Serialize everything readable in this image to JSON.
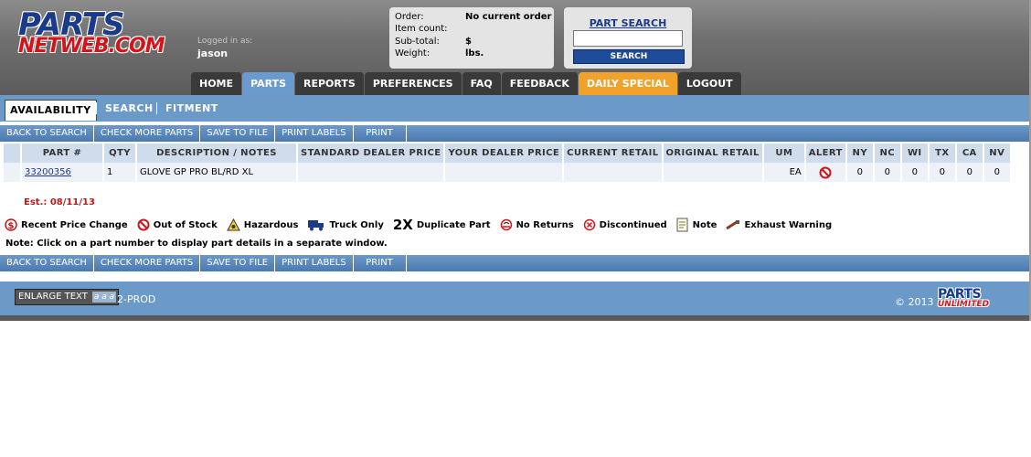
{
  "logo": {
    "line1": "PARTS",
    "line2": "NETWEB.COM"
  },
  "login": {
    "label": "Logged in as:",
    "user": "jason"
  },
  "order": {
    "rows": [
      {
        "label": "Order:",
        "value": "No current order"
      },
      {
        "label": "Item count:",
        "value": ""
      },
      {
        "label": "Sub-total:",
        "value": "$"
      },
      {
        "label": "Weight:",
        "value": "lbs."
      }
    ]
  },
  "part_search": {
    "title": "PART SEARCH",
    "input_value": "",
    "button": "SEARCH"
  },
  "nav": [
    "HOME",
    "PARTS",
    "REPORTS",
    "PREFERENCES",
    "FAQ",
    "FEEDBACK",
    "DAILY SPECIAL",
    "LOGOUT"
  ],
  "subtabs": {
    "active": "AVAILABILITY",
    "search": "SEARCH",
    "fitment": "FITMENT"
  },
  "toolbar": [
    "BACK TO SEARCH",
    "CHECK MORE PARTS",
    "SAVE TO FILE",
    "PRINT LABELS",
    "PRINT"
  ],
  "table": {
    "headers": [
      "PART #",
      "QTY",
      "DESCRIPTION / NOTES",
      "STANDARD DEALER PRICE",
      "YOUR DEALER PRICE",
      "CURRENT RETAIL",
      "ORIGINAL RETAIL",
      "UM",
      "ALERT",
      "NY",
      "NC",
      "WI",
      "TX",
      "CA",
      "NV"
    ],
    "row": {
      "part": "33200356",
      "qty": "1",
      "description": "GLOVE GP PRO BL/RD XL",
      "standard_price": "",
      "your_price": "",
      "current_retail": "",
      "original_retail": "",
      "um": "EA",
      "ny": "0",
      "nc": "0",
      "wi": "0",
      "tx": "0",
      "ca": "0",
      "nv": "0"
    }
  },
  "est": "Est.: 08/11/13",
  "legend": {
    "price_change": "Recent Price Change",
    "out_of_stock": "Out of Stock",
    "hazardous": "Hazardous",
    "truck_only": "Truck Only",
    "dup_mark": "2X",
    "duplicate": "Duplicate Part",
    "no_returns": "No Returns",
    "discontinued": "Discontinued",
    "note": "Note",
    "exhaust": "Exhaust Warning"
  },
  "note": "Note: Click on a part number to display part details in a separate window.",
  "footer": {
    "enlarge": "ENLARGE TEXT",
    "aa": "a a a",
    "env": "2-PROD",
    "copyright": "© 2013",
    "pu_line1": "PARTS",
    "pu_line2": "UNLIMITED"
  },
  "colors": {
    "brand_blue": "#1a3a8c",
    "brand_red": "#d4141b",
    "bar_blue": "#6b9ac9",
    "special_orange": "#f0a22a"
  }
}
